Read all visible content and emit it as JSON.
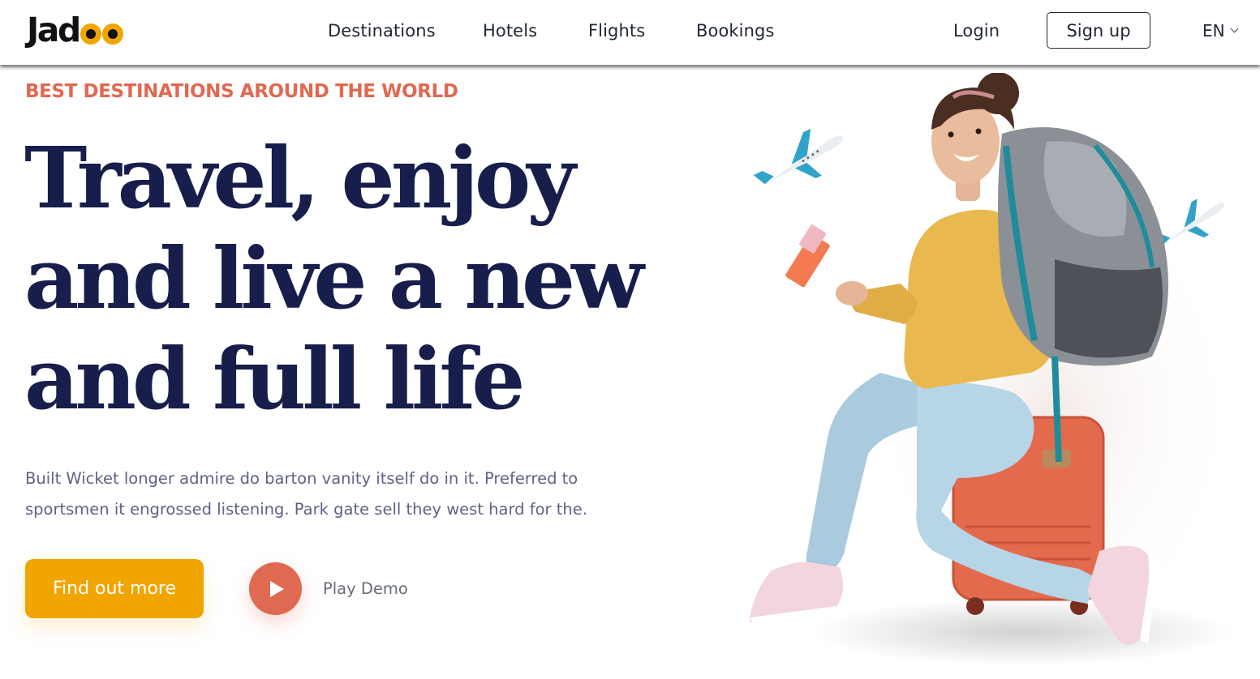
{
  "header": {
    "logo_text": "Jad",
    "nav": [
      {
        "label": "Destinations"
      },
      {
        "label": "Hotels"
      },
      {
        "label": "Flights"
      },
      {
        "label": "Bookings"
      }
    ],
    "login_label": "Login",
    "signup_label": "Sign up",
    "language": "EN"
  },
  "hero": {
    "eyebrow": "BEST DESTINATIONS AROUND THE WORLD",
    "headline_lines": [
      "Travel, enjoy",
      "and live a new",
      "and full life"
    ],
    "lead_lines": [
      "Built Wicket longer admire do barton vanity itself do in it. Preferred to",
      "sportsmen it engrossed listening. Park gate sell they west hard for the."
    ],
    "cta_label": "Find out more",
    "play_label": "Play Demo"
  },
  "colors": {
    "primary": "#F1A501",
    "accent": "#DF6951",
    "heading": "#181E4B",
    "body_text": "#5E6282"
  },
  "icons": {
    "play": "play-icon",
    "dropdown": "chevron-down-icon",
    "plane": "airplane-icon"
  }
}
